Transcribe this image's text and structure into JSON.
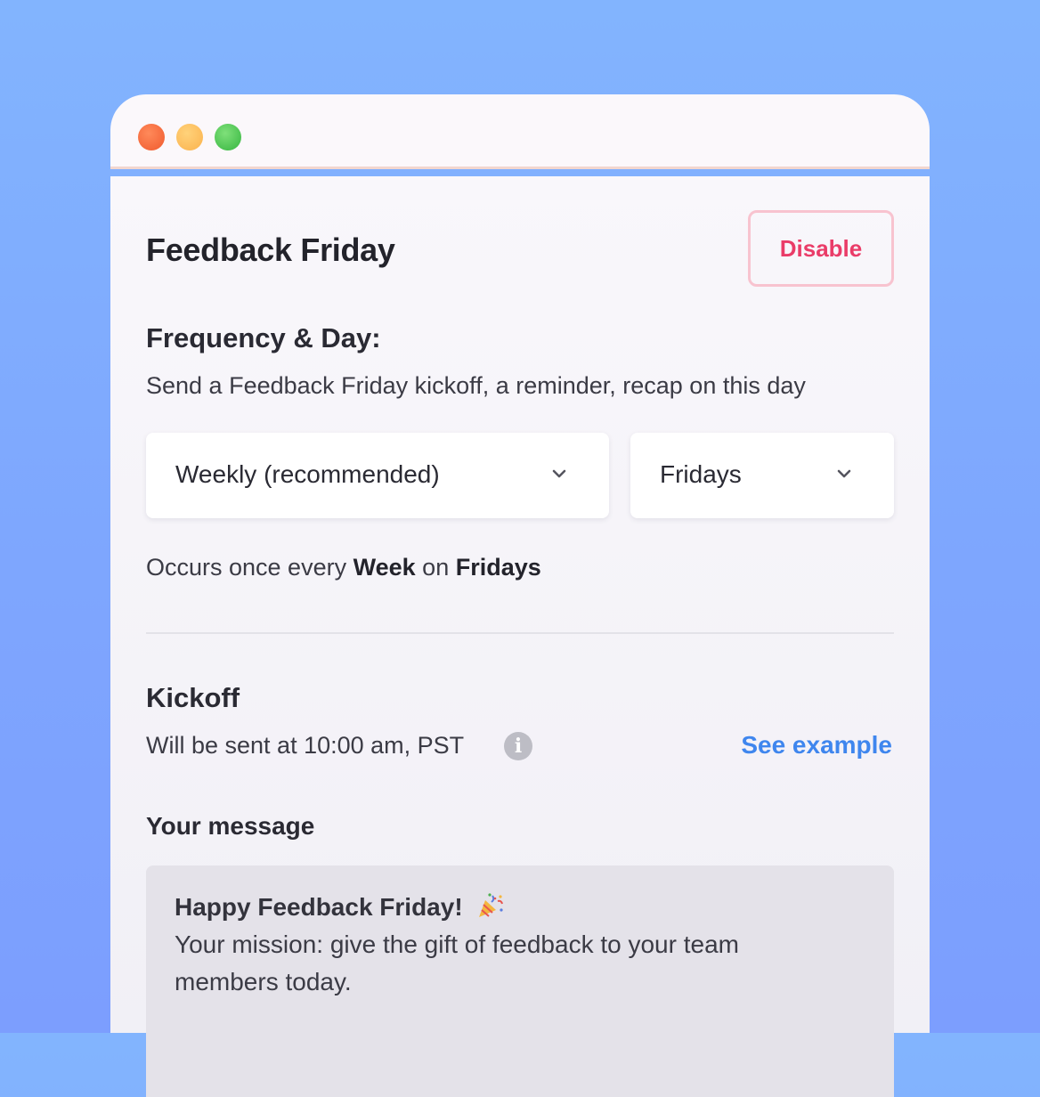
{
  "window": {
    "controls": [
      "close",
      "minimize",
      "zoom"
    ]
  },
  "header": {
    "title": "Feedback Friday",
    "disable_label": "Disable"
  },
  "frequency": {
    "heading": "Frequency & Day:",
    "description": "Send a Feedback Friday kickoff, a reminder, recap on this day",
    "frequency_selected": "Weekly (recommended)",
    "day_selected": "Fridays",
    "occurs_prefix": "Occurs once every",
    "occurs_unit": "Week",
    "occurs_on": "on",
    "occurs_day": "Fridays"
  },
  "kickoff": {
    "heading": "Kickoff",
    "schedule": "Will be sent at 10:00 am, PST",
    "info_glyph": "i",
    "see_example_label": "See example"
  },
  "message": {
    "label": "Your message",
    "headline": "Happy Feedback Friday!",
    "headline_icon": "party-popper-icon",
    "body": "Your mission: give the gift of feedback to your team members today."
  },
  "colors": {
    "background": "#80aafe",
    "disable_text": "#ea3c68",
    "disable_border": "#f8c3cf",
    "link": "#3f86ee",
    "message_box": "#e4e2e9"
  }
}
